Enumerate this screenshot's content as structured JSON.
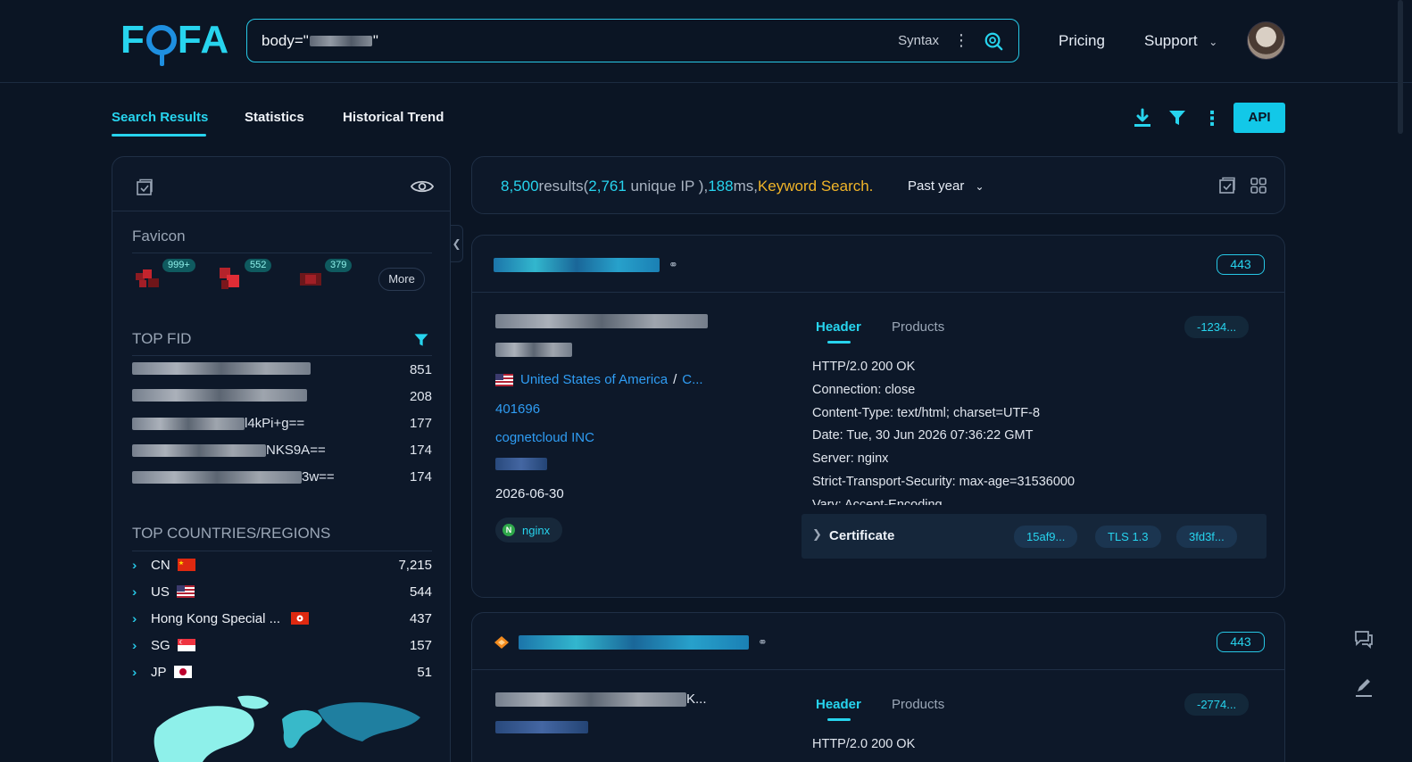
{
  "header": {
    "logo_text": "FOFA",
    "search_query": "body=\"",
    "search_query_end": "\"",
    "syntax_label": "Syntax",
    "pricing_label": "Pricing",
    "support_label": "Support"
  },
  "tabs": {
    "search_results": "Search Results",
    "statistics": "Statistics",
    "historical_trend": "Historical Trend",
    "api_label": "API"
  },
  "left": {
    "favicon_title": "Favicon",
    "favicons": [
      {
        "count": "999+"
      },
      {
        "count": "552"
      },
      {
        "count": "379"
      }
    ],
    "more_label": "More",
    "top_fid_title": "TOP FID",
    "fids": [
      {
        "tail": "",
        "count": "851"
      },
      {
        "tail": "",
        "count": "208"
      },
      {
        "tail": "l4kPi+g==",
        "count": "177"
      },
      {
        "tail": "NKS9A==",
        "count": "174"
      },
      {
        "tail": "3w==",
        "count": "174"
      }
    ],
    "top_countries_title": "TOP COUNTRIES/REGIONS",
    "countries": [
      {
        "name": "CN",
        "count": "7,215"
      },
      {
        "name": "US",
        "count": "544"
      },
      {
        "name": "Hong Kong Special ...",
        "count": "437"
      },
      {
        "name": "SG",
        "count": "157"
      },
      {
        "name": "JP",
        "count": "51"
      }
    ]
  },
  "summary": {
    "results_count": "8,500",
    "results_word": "results(",
    "unique_ip": "2,761",
    "unique_word": " unique IP ),",
    "ms": "188",
    "ms_word": "ms,",
    "mode": "Keyword Search.",
    "range": "Past year"
  },
  "results": [
    {
      "port": "443",
      "country": "United States of America",
      "region_trunc": "C...",
      "asn": "401696",
      "org": "cognetcloud INC",
      "date": "2026-06-30",
      "product": "nginx",
      "tab_header": "Header",
      "tab_products": "Products",
      "hash": "-1234...",
      "headers": [
        "HTTP/2.0 200 OK",
        "Connection: close",
        "Content-Type: text/html; charset=UTF-8",
        "Date: Tue, 30 Jun 2026 07:36:22 GMT",
        "Server: nginx",
        "Strict-Transport-Security: max-age=31536000",
        "Vary: Accept-Encoding"
      ],
      "certificate_label": "Certificate",
      "cert_chips": [
        "15af9...",
        "TLS 1.3",
        "3fd3f..."
      ]
    },
    {
      "port": "443",
      "title_trunc": "K...",
      "tab_header": "Header",
      "tab_products": "Products",
      "hash": "-2774...",
      "headers": [
        "HTTP/2.0 200 OK"
      ]
    }
  ],
  "colors": {
    "accent": "#27d4ee",
    "background": "#0b1524",
    "panel": "#0d1829",
    "keyword": "#f0b429",
    "link": "#2f9df4"
  }
}
